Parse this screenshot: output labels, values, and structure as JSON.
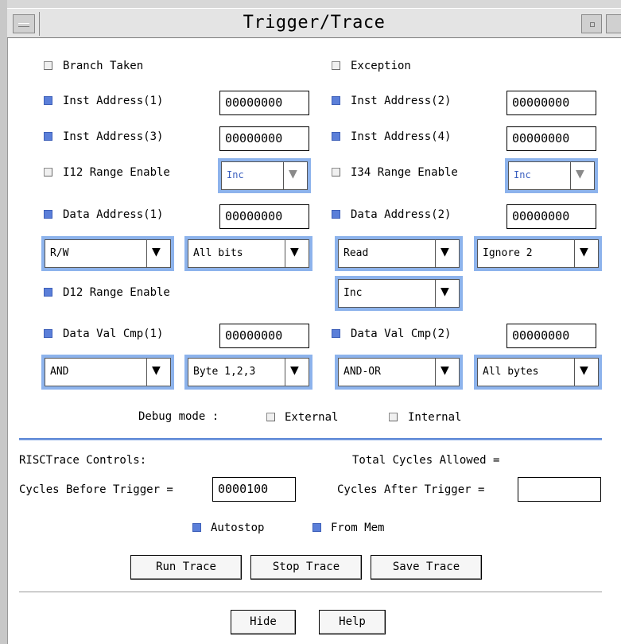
{
  "window": {
    "title": "Trigger/Trace"
  },
  "triggers": {
    "branch_taken": {
      "label": "Branch Taken",
      "checked": false
    },
    "exception": {
      "label": "Exception",
      "checked": false
    },
    "inst_addr_1": {
      "label": "Inst Address(1)",
      "checked": true,
      "value": "00000000"
    },
    "inst_addr_2": {
      "label": "Inst Address(2)",
      "checked": true,
      "value": "00000000"
    },
    "inst_addr_3": {
      "label": "Inst Address(3)",
      "checked": true,
      "value": "00000000"
    },
    "inst_addr_4": {
      "label": "Inst Address(4)",
      "checked": true,
      "value": "00000000"
    },
    "i12_range": {
      "label": "I12 Range Enable",
      "checked": false,
      "select": "Inc"
    },
    "i34_range": {
      "label": "I34 Range Enable",
      "checked": false,
      "select": "Inc"
    },
    "data_addr_1": {
      "label": "Data Address(1)",
      "checked": true,
      "value": "00000000"
    },
    "data_addr_2": {
      "label": "Data Address(2)",
      "checked": true,
      "value": "00000000"
    },
    "d1_access": "R/W",
    "d1_bits": "All bits",
    "d2_access": "Read",
    "d2_bits": "Ignore 2",
    "d12_range": {
      "label": "D12 Range Enable",
      "checked": true,
      "select": "Inc"
    },
    "data_val_1": {
      "label": "Data Val Cmp(1)",
      "checked": true,
      "value": "00000000"
    },
    "data_val_2": {
      "label": "Data Val Cmp(2)",
      "checked": true,
      "value": "00000000"
    },
    "v1_logic": "AND",
    "v1_bytes": "Byte 1,2,3",
    "v2_logic": "AND-OR",
    "v2_bytes": "All bytes"
  },
  "debug": {
    "label": "Debug mode :",
    "external": {
      "label": "External",
      "checked": false
    },
    "internal": {
      "label": "Internal",
      "checked": false
    }
  },
  "trace": {
    "controls_label": "RISCTrace Controls:",
    "total_cycles_label": "Total Cycles Allowed =",
    "before_label": "Cycles Before Trigger =",
    "before_value": "0000100",
    "after_label": "Cycles After Trigger =",
    "after_value": "",
    "autostop": {
      "label": "Autostop",
      "checked": true
    },
    "from_mem": {
      "label": "From Mem",
      "checked": true
    },
    "run_label": "Run Trace",
    "stop_label": "Stop Trace",
    "save_label": "Save Trace"
  },
  "footer": {
    "hide_label": "Hide",
    "help_label": "Help"
  },
  "colors": {
    "accent": "#5b7fd9",
    "combo_frame": "#8db3ec",
    "separator": "#5b87d6"
  }
}
